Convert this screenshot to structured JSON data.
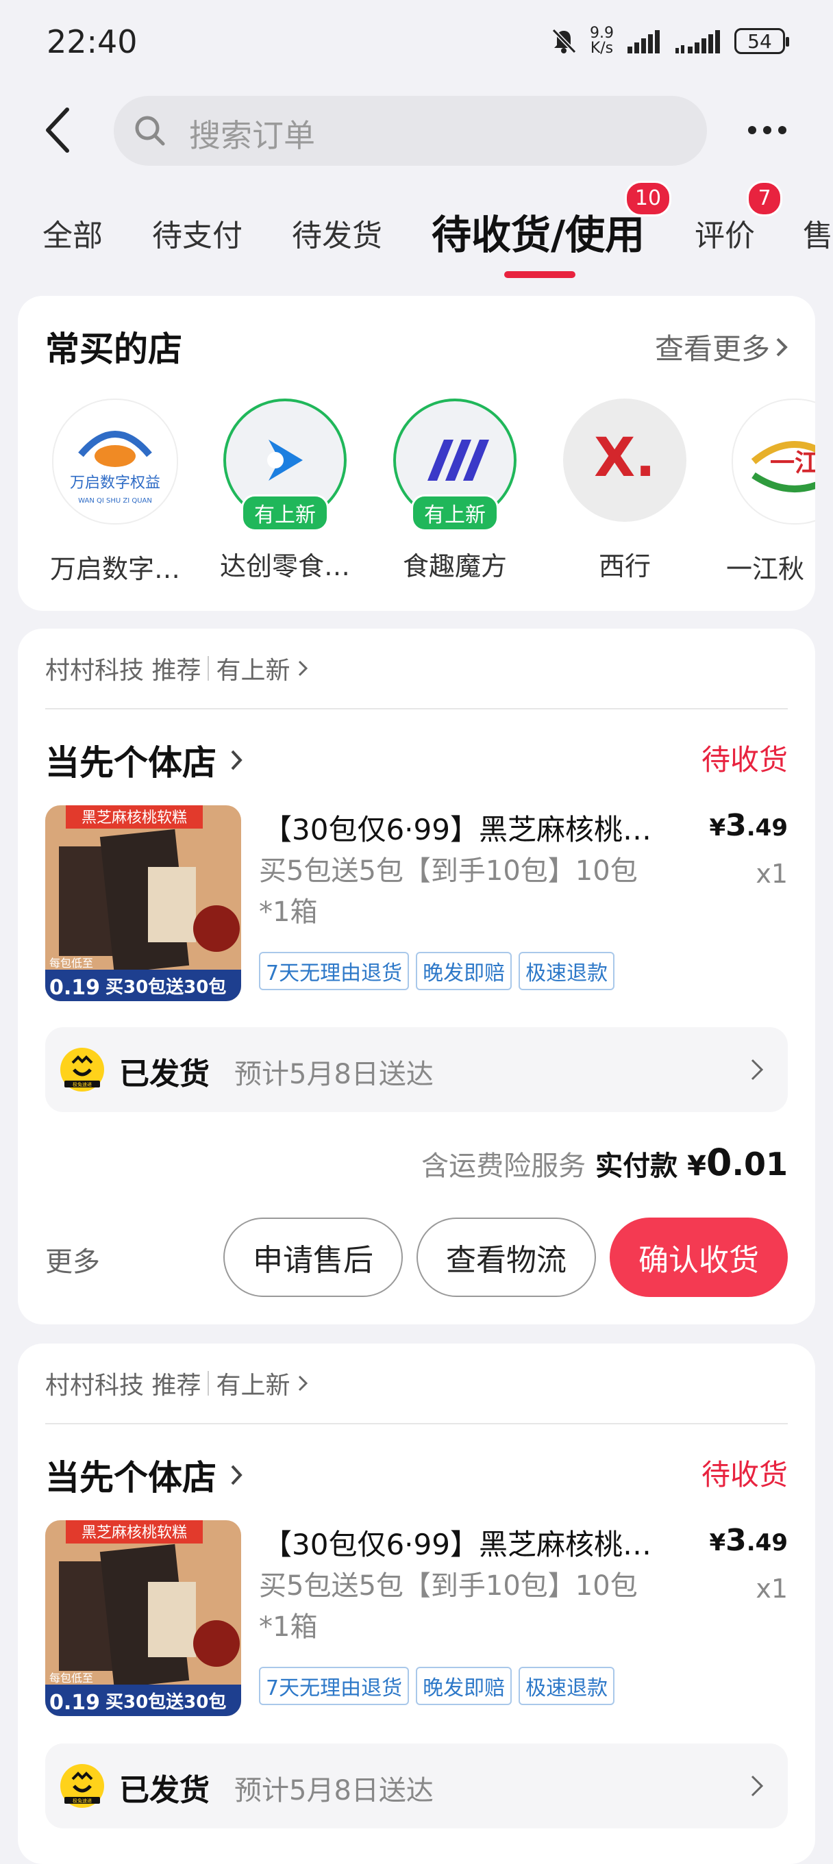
{
  "status_bar": {
    "time": "22:40",
    "speed_value": "9.9",
    "speed_unit": "K/s",
    "battery": "54"
  },
  "header": {
    "search_placeholder": "搜索订单"
  },
  "tabs": [
    {
      "label": "全部"
    },
    {
      "label": "待支付"
    },
    {
      "label": "待发货"
    },
    {
      "label": "待收货/使用",
      "badge": "10",
      "active": true
    },
    {
      "label": "评价",
      "badge": "7"
    },
    {
      "label": "售"
    }
  ],
  "frequent_stores": {
    "title": "常买的店",
    "see_more": "查看更多",
    "stores": [
      {
        "name": "万启数字…",
        "logo_text": "万启数字权益",
        "logo_sub": "WAN QI SHU ZI QUAN"
      },
      {
        "name": "达创零食…",
        "tag": "有上新"
      },
      {
        "name": "食趣魔方",
        "tag": "有上新"
      },
      {
        "name": "西行",
        "logo_text": "X."
      },
      {
        "name": "一江秋",
        "logo_text": "一江"
      }
    ]
  },
  "orders": [
    {
      "recommender": "村村科技 推荐",
      "new_tag": "有上新",
      "shop": "当先个体店",
      "status": "待收货",
      "product": {
        "title": "【30包仅6·99】黑芝麻核桃…",
        "sku_line1": "买5包送5包【到手10包】10包",
        "sku_line2": "*1箱",
        "price_symbol": "¥",
        "price_int": "3",
        "price_dec": ".49",
        "qty": "x1",
        "img_banner": "黑芝麻核桃软糕",
        "img_price": "0.19",
        "img_price_label": "每包低至",
        "img_promo": "买30包送30包"
      },
      "service_tags": [
        "7天无理由退货",
        "晚发即赔",
        "极速退款"
      ],
      "shipping": {
        "status": "已发货",
        "eta": "预计5月8日送达",
        "courier_label": "极兔速递"
      },
      "payment": {
        "insurance": "含运费险服务",
        "paid_label": "实付款",
        "symbol": "¥",
        "int": "0",
        "dec": ".01"
      },
      "actions": {
        "more": "更多",
        "after_sale": "申请售后",
        "logistics": "查看物流",
        "confirm": "确认收货"
      }
    },
    {
      "recommender": "村村科技 推荐",
      "new_tag": "有上新",
      "shop": "当先个体店",
      "status": "待收货",
      "product": {
        "title": "【30包仅6·99】黑芝麻核桃…",
        "sku_line1": "买5包送5包【到手10包】10包",
        "sku_line2": "*1箱",
        "price_symbol": "¥",
        "price_int": "3",
        "price_dec": ".49",
        "qty": "x1",
        "img_banner": "黑芝麻核桃软糕",
        "img_price": "0.19",
        "img_price_label": "每包低至",
        "img_promo": "买30包送30包"
      },
      "service_tags": [
        "7天无理由退货",
        "晚发即赔",
        "极速退款"
      ],
      "shipping": {
        "status": "已发货",
        "eta": "预计5月8日送达",
        "courier_label": "极兔速递"
      }
    }
  ],
  "colors": {
    "accent_red": "#e8233f",
    "button_red": "#f43a52",
    "new_green": "#20b75a",
    "service_blue": "#2d78c8"
  }
}
